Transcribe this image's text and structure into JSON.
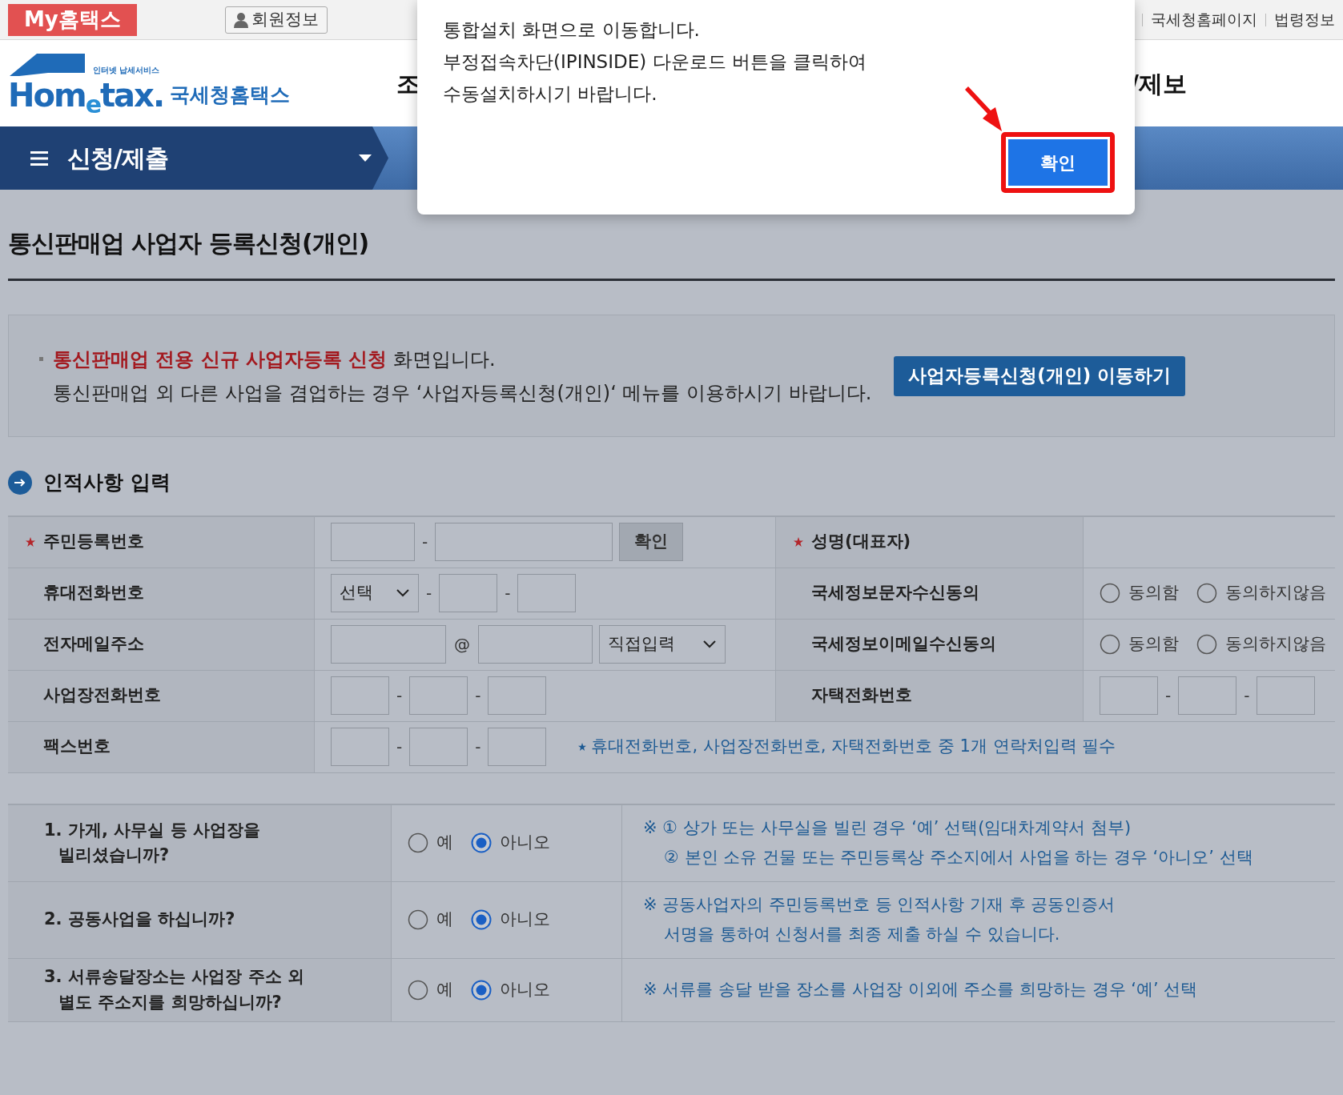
{
  "top_bar": {
    "my_hometax": "My홈택스",
    "member_info": "회원정보",
    "links": [
      "국세청홈페이지",
      "법령정보"
    ]
  },
  "header": {
    "logo_tagline": "인터넷 납세서비스",
    "logo_word": "Hom$_{e}$tax.",
    "logo_name": "국세청홈택스",
    "menu_fragments": [
      "조",
      "/제보"
    ]
  },
  "nav": {
    "title": "신청/제출"
  },
  "dialog": {
    "lines": [
      "통합설치 화면으로 이동합니다.",
      "부정접속차단(IPINSIDE) 다운로드 버튼을 클릭하여",
      "수동설치하시기 바랍니다."
    ],
    "ok": "확인"
  },
  "page_title": "통신판매업 사업자 등록신청(개인)",
  "notice": {
    "lines": [
      "**통신판매업 전용 신규 사업자등록 신청** 화면입니다.",
      "통신판매업 외 다른 사업을 겸업하는 경우 ‘사업자등록신청(개인)‘  메뉴를 이용하시기 바랍니다."
    ],
    "button": "사업자등록신청(개인) 이동하기"
  },
  "section_title": "인적사항 입력",
  "form_rows": [
    {
      "left": {
        "label": "주민등록번호",
        "required": true,
        "kind": "rrn",
        "separator": "-",
        "button": "확인"
      },
      "right": {
        "label": "성명(대표자)",
        "required": true,
        "kind": "empty"
      }
    },
    {
      "left": {
        "label": "휴대전화번호",
        "required": false,
        "kind": "mobile",
        "select": "선택",
        "separators": [
          "-",
          "-"
        ]
      },
      "right": {
        "label": "국세정보문자수신동의",
        "required": false,
        "kind": "radios",
        "options": [
          {
            "label": "동의함",
            "selected": false
          },
          {
            "label": "동의하지않음",
            "selected": false
          }
        ]
      }
    },
    {
      "left": {
        "label": "전자메일주소",
        "required": false,
        "kind": "email",
        "at": "@",
        "select": "직접입력"
      },
      "right": {
        "label": "국세정보이메일수신동의",
        "required": false,
        "kind": "radios",
        "options": [
          {
            "label": "동의함",
            "selected": false
          },
          {
            "label": "동의하지않음",
            "selected": false
          }
        ]
      }
    },
    {
      "left": {
        "label": "사업장전화번호",
        "required": false,
        "kind": "phone",
        "separators": [
          "-",
          "-"
        ]
      },
      "right": {
        "label": "자택전화번호",
        "required": false,
        "kind": "phone",
        "separators": [
          "-",
          "-"
        ]
      }
    },
    {
      "left": {
        "label": "팩스번호",
        "required": false,
        "kind": "phone",
        "separators": [
          "-",
          "-"
        ],
        "note": "휴대전화번호, 사업장전화번호, 자택전화번호 중 1개 연락처입력 필수"
      }
    }
  ],
  "questions": [
    {
      "lines": [
        "1. 가게, 사무실 등 사업장을",
        "빌리셨습니까?"
      ],
      "options": [
        {
          "label": "예",
          "selected": false
        },
        {
          "label": "아니오",
          "selected": true
        }
      ],
      "notes": [
        "※ ① 상가 또는 사무실을 빌린 경우 ‘예’ 선택(임대차계약서 첨부)",
        "② 본인 소유 건물 또는 주민등록상 주소지에서 사업을 하는 경우 ‘아니오’ 선택"
      ]
    },
    {
      "lines": [
        "2. 공동사업을 하십니까?"
      ],
      "options": [
        {
          "label": "예",
          "selected": false
        },
        {
          "label": "아니오",
          "selected": true
        }
      ],
      "notes": [
        "※ 공동사업자의 주민등록번호 등 인적사항 기재 후 공동인증서",
        "서명을 통하여 신청서를 최종 제출 하실 수 있습니다."
      ]
    },
    {
      "lines": [
        "3. 서류송달장소는 사업장 주소 외",
        "별도 주소지를 희망하십니까?"
      ],
      "options": [
        {
          "label": "예",
          "selected": false
        },
        {
          "label": "아니오",
          "selected": true
        }
      ],
      "notes": [
        "※ 서류를 송달 받을 장소를 사업장 이외에 주소를 희망하는 경우 ‘예’ 선택"
      ]
    }
  ]
}
